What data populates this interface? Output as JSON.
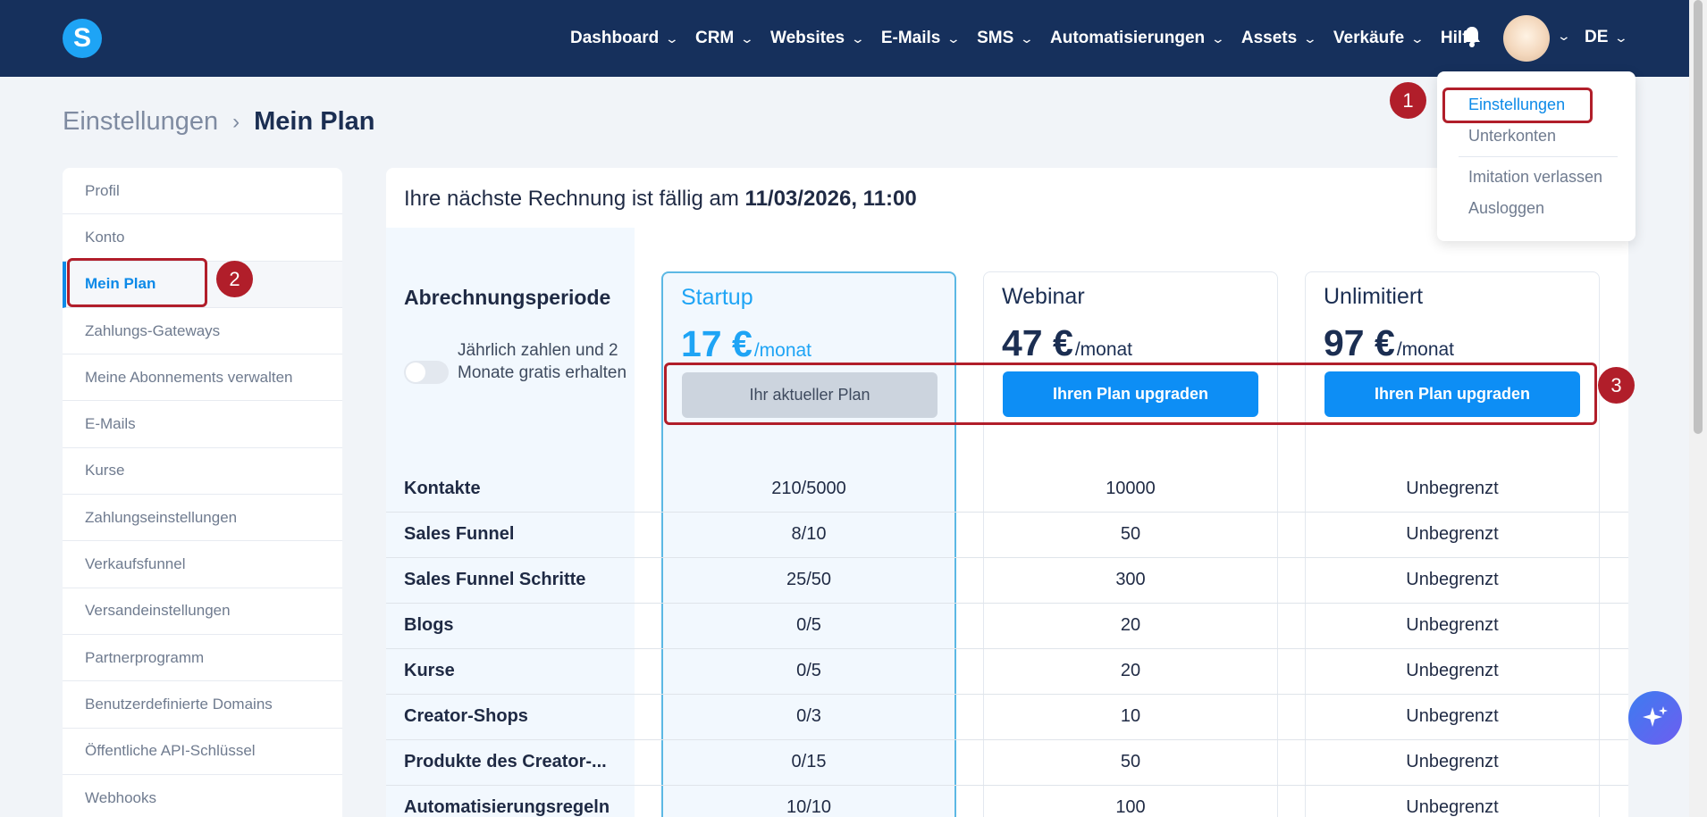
{
  "nav": {
    "logo": "S",
    "items": [
      {
        "label": "Dashboard",
        "dropdown": true
      },
      {
        "label": "CRM",
        "dropdown": true
      },
      {
        "label": "Websites",
        "dropdown": true
      },
      {
        "label": "E-Mails",
        "dropdown": true
      },
      {
        "label": "SMS",
        "dropdown": true
      },
      {
        "label": "Automatisierungen",
        "dropdown": true
      },
      {
        "label": "Assets",
        "dropdown": true
      },
      {
        "label": "Verkäufe",
        "dropdown": true
      },
      {
        "label": "Hilfe",
        "dropdown": false
      }
    ],
    "language": "DE"
  },
  "breadcrumb": {
    "parent": "Einstellungen",
    "current": "Mein Plan"
  },
  "sidebar": {
    "items": [
      {
        "label": "Profil"
      },
      {
        "label": "Konto"
      },
      {
        "label": "Mein Plan",
        "active": true
      },
      {
        "label": "Zahlungs-Gateways"
      },
      {
        "label": "Meine Abonnements verwalten"
      },
      {
        "label": "E-Mails"
      },
      {
        "label": "Kurse"
      },
      {
        "label": "Zahlungseinstellungen"
      },
      {
        "label": "Verkaufsfunnel"
      },
      {
        "label": "Versandeinstellungen"
      },
      {
        "label": "Partnerprogramm"
      },
      {
        "label": "Benutzerdefinierte Domains"
      },
      {
        "label": "Öffentliche API-Schlüssel"
      },
      {
        "label": "Webhooks"
      }
    ]
  },
  "main": {
    "invoice_text": "Ihre nächste Rechnung ist fällig am",
    "invoice_date": "11/03/2026, 11:00",
    "billing_title": "Abrechnungsperiode",
    "toggle_label": "Jährlich zahlen und 2 Monate gratis erhalten",
    "toggle_on": false,
    "plans": [
      {
        "name": "Startup",
        "price": "17 €",
        "unit": "/monat",
        "button": "Ihr aktueller Plan",
        "current": true
      },
      {
        "name": "Webinar",
        "price": "47 €",
        "unit": "/monat",
        "button": "Ihren Plan upgraden",
        "current": false
      },
      {
        "name": "Unlimitiert",
        "price": "97 €",
        "unit": "/monat",
        "button": "Ihren Plan upgraden",
        "current": false
      }
    ],
    "features": [
      {
        "label": "Kontakte",
        "values": [
          "210/5000",
          "10000",
          "Unbegrenzt"
        ]
      },
      {
        "label": "Sales Funnel",
        "values": [
          "8/10",
          "50",
          "Unbegrenzt"
        ]
      },
      {
        "label": "Sales Funnel Schritte",
        "values": [
          "25/50",
          "300",
          "Unbegrenzt"
        ]
      },
      {
        "label": "Blogs",
        "values": [
          "0/5",
          "20",
          "Unbegrenzt"
        ]
      },
      {
        "label": "Kurse",
        "values": [
          "0/5",
          "20",
          "Unbegrenzt"
        ]
      },
      {
        "label": "Creator-Shops",
        "values": [
          "0/3",
          "10",
          "Unbegrenzt"
        ]
      },
      {
        "label": "Produkte des Creator-...",
        "values": [
          "0/15",
          "50",
          "Unbegrenzt"
        ]
      },
      {
        "label": "Automatisierungsregeln",
        "values": [
          "10/10",
          "100",
          "Unbegrenzt"
        ]
      }
    ]
  },
  "user_menu": {
    "items": [
      "Einstellungen",
      "Unterkonten",
      "Imitation verlassen",
      "Ausloggen"
    ]
  },
  "annotations": {
    "badge1": "1",
    "badge2": "2",
    "badge3": "3"
  },
  "colors": {
    "nav_bg": "#16305c",
    "accent": "#0d8ef5",
    "annotation": "#b11e2a"
  },
  "icons": {
    "bell": "bell-icon",
    "fab": "sparkle-icon"
  }
}
